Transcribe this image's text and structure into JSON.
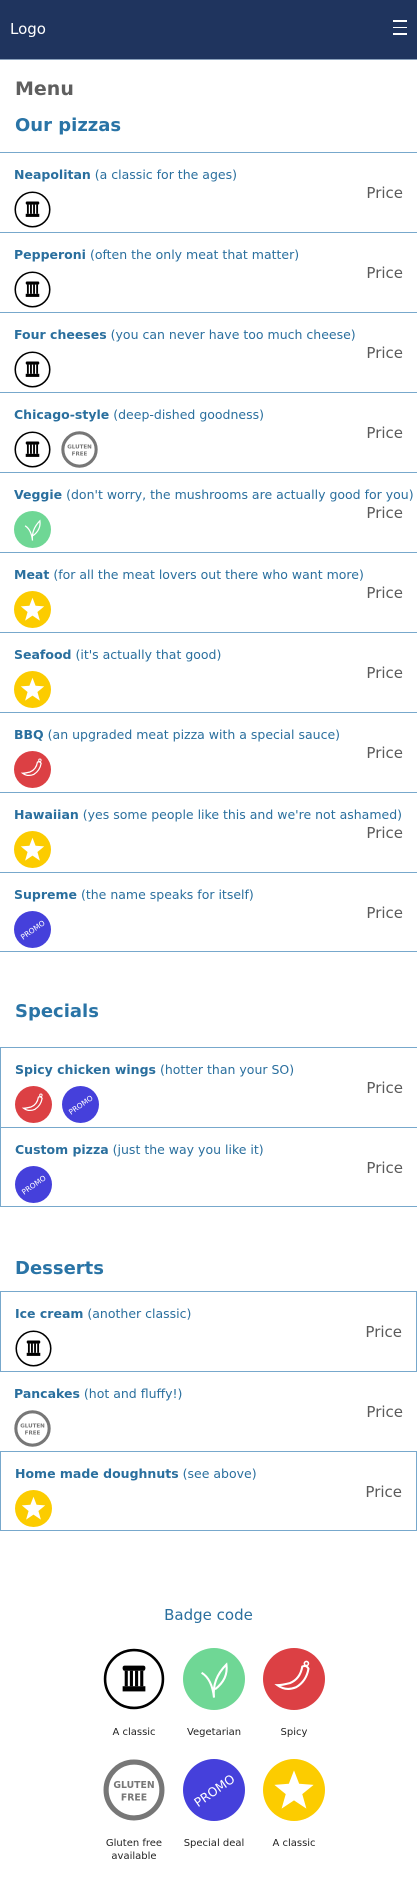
{
  "header": {
    "logo": "Logo",
    "menu_icon": "hamburger-icon"
  },
  "page_title": "Menu",
  "sections": [
    {
      "title": "Our pizzas",
      "items": [
        {
          "name": "Neapolitan",
          "desc": "(a classic for the ages)",
          "price": "Price",
          "badges": [
            "classic"
          ]
        },
        {
          "name": "Pepperoni",
          "desc": "(often the only meat that matter)",
          "price": "Price",
          "badges": [
            "classic"
          ]
        },
        {
          "name": "Four cheeses",
          "desc": "(you can never have too much cheese)",
          "price": "Price",
          "badges": [
            "classic"
          ]
        },
        {
          "name": "Chicago-style",
          "desc": "(deep-dished goodness)",
          "price": "Price",
          "badges": [
            "classic",
            "gluten"
          ]
        },
        {
          "name": "Veggie",
          "desc": "(don't worry, the mushrooms are actually good for you)",
          "price": "Price",
          "badges": [
            "veg"
          ]
        },
        {
          "name": "Meat",
          "desc": "(for all the meat lovers out there who want more)",
          "price": "Price",
          "badges": [
            "star"
          ]
        },
        {
          "name": "Seafood",
          "desc": "(it's actually that good)",
          "price": "Price",
          "badges": [
            "star"
          ]
        },
        {
          "name": "BBQ",
          "desc": "(an upgraded meat pizza with a special sauce)",
          "price": "Price",
          "badges": [
            "spicy"
          ]
        },
        {
          "name": "Hawaiian",
          "desc": "(yes some people like this and we're not ashamed)",
          "price": "Price",
          "badges": [
            "star"
          ]
        },
        {
          "name": "Supreme",
          "desc": "(the name speaks for itself)",
          "price": "Price",
          "badges": [
            "promo"
          ]
        }
      ]
    },
    {
      "title": "Specials",
      "items": [
        {
          "name": "Spicy chicken wings",
          "desc": "(hotter than your SO)",
          "price": "Price",
          "badges": [
            "spicy",
            "promo"
          ]
        },
        {
          "name": "Custom pizza",
          "desc": "(just the way you like it)",
          "price": "Price",
          "badges": [
            "promo"
          ]
        }
      ]
    },
    {
      "title": "Desserts",
      "items": [
        {
          "name": "Ice cream",
          "desc": "(another classic)",
          "price": "Price",
          "badges": [
            "classic"
          ]
        },
        {
          "name": "Pancakes",
          "desc": "(hot and fluffy!)",
          "price": "Price",
          "badges": [
            "gluten"
          ]
        },
        {
          "name": "Home made doughnuts",
          "desc": "(see above)",
          "price": "Price",
          "badges": [
            "star"
          ]
        }
      ]
    }
  ],
  "badge_code": {
    "title": "Badge code",
    "items": [
      {
        "badge": "classic",
        "label": "A classic"
      },
      {
        "badge": "veg",
        "label": "Vegetarian"
      },
      {
        "badge": "spicy",
        "label": "Spicy"
      },
      {
        "badge": "gluten",
        "label": "Gluten free available"
      },
      {
        "badge": "promo",
        "label": "Special deal"
      },
      {
        "badge": "star",
        "label": "A classic"
      }
    ]
  },
  "badge_text": {
    "gluten": [
      "GLUTEN",
      "FREE"
    ],
    "promo": "PROMO"
  },
  "colors": {
    "header": "#1f345e",
    "accent": "#2a74a6",
    "veg": "#6fd795",
    "spicy": "#dc4044",
    "promo": "#4540db",
    "star": "#fccc00",
    "gluten": "#777777"
  }
}
